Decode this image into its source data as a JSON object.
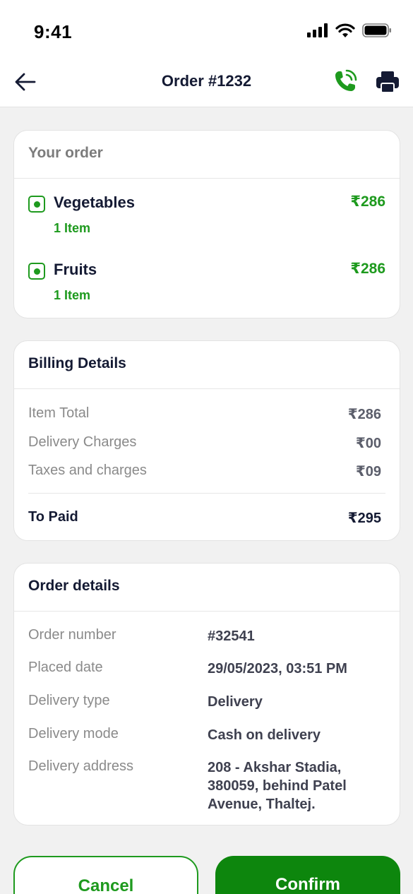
{
  "status_bar": {
    "time": "9:41"
  },
  "header": {
    "title": "Order #1232"
  },
  "your_order": {
    "title": "Your order",
    "items": [
      {
        "name": "Vegetables",
        "count": "1 Item",
        "price": "₹286"
      },
      {
        "name": "Fruits",
        "count": "1 Item",
        "price": "₹286"
      }
    ]
  },
  "billing": {
    "title": "Billing Details",
    "rows": [
      {
        "label": "Item Total",
        "value": "₹286"
      },
      {
        "label": "Delivery Charges",
        "value": "₹00"
      },
      {
        "label": "Taxes and charges",
        "value": "₹09"
      }
    ],
    "total": {
      "label": "To Paid",
      "value": "₹295"
    }
  },
  "order_details": {
    "title": "Order details",
    "rows": [
      {
        "label": "Order number",
        "value": "#32541"
      },
      {
        "label": "Placed date",
        "value": "29/05/2023, 03:51 PM"
      },
      {
        "label": "Delivery type",
        "value": "Delivery"
      },
      {
        "label": "Delivery mode",
        "value": "Cash on delivery"
      },
      {
        "label": "Delivery address",
        "value": "208 - Akshar Stadia, 380059, behind Patel Avenue, Thaltej."
      }
    ]
  },
  "actions": {
    "cancel": "Cancel",
    "confirm": "Confirm"
  },
  "colors": {
    "accent": "#1e9a1e",
    "confirm_bg": "#0d860d",
    "background": "#f1f1f1"
  }
}
